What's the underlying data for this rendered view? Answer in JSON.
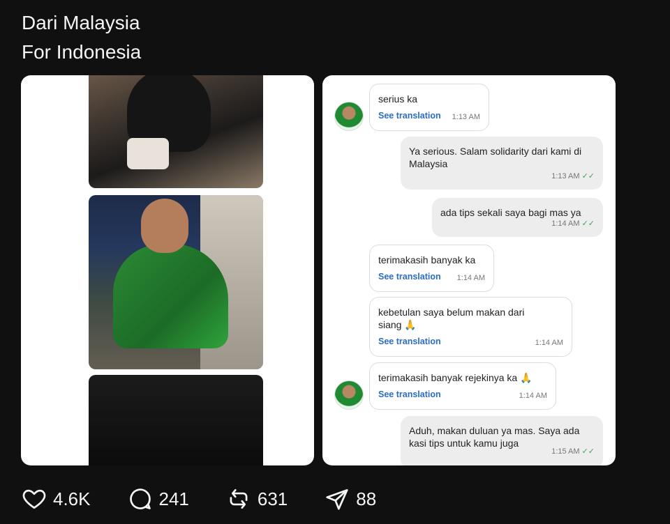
{
  "post": {
    "lines": [
      "Dari Malaysia",
      "For Indonesia"
    ]
  },
  "chat": {
    "see_translation": "See translation",
    "messages": [
      {
        "dir": "in",
        "text": "serius ka",
        "time": "1:13 AM"
      },
      {
        "dir": "out",
        "text": "Ya serious. Salam solidarity dari kami di Malaysia",
        "time": "1:13 AM"
      },
      {
        "dir": "out",
        "text": "ada tips sekali saya bagi mas ya",
        "time": "1:14 AM"
      },
      {
        "dir": "in",
        "text": "terimakasih banyak ka",
        "time": "1:14 AM"
      },
      {
        "dir": "in",
        "text": "kebetulan saya belum makan dari siang 🙏",
        "time": "1:14 AM"
      },
      {
        "dir": "in",
        "text": "terimakasih banyak rejekinya ka 🙏",
        "time": "1:14 AM"
      },
      {
        "dir": "out",
        "text": "Aduh, makan duluan ya mas. Saya ada kasi tips untuk kamu juga",
        "time": "1:15 AM"
      }
    ]
  },
  "actions": {
    "likes": "4.6K",
    "comments": "241",
    "reposts": "631",
    "shares": "88"
  },
  "icons": [
    "heart-icon",
    "comment-icon",
    "repost-icon",
    "send-icon"
  ],
  "colors": {
    "background": "#101010",
    "text": "#f3f5f7",
    "link": "#2b6cc4",
    "tick": "#3aa45a"
  }
}
